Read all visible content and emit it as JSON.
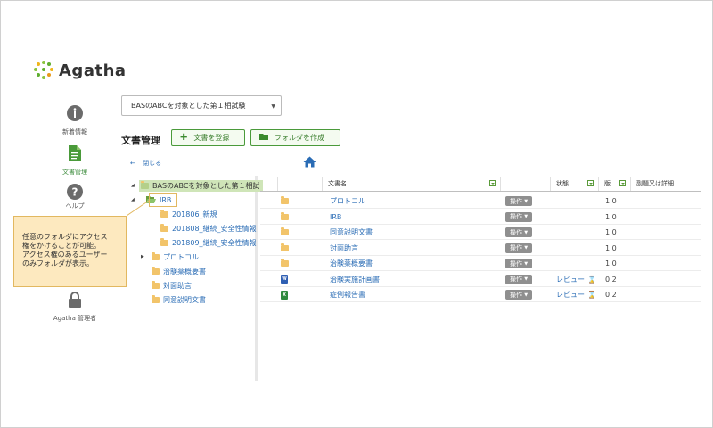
{
  "app": {
    "name": "Agatha"
  },
  "nav": [
    {
      "label": "新着情報",
      "icon": "info-icon"
    },
    {
      "label": "文書管理",
      "icon": "document-icon",
      "active": true
    },
    {
      "label": "ヘルプ",
      "icon": "help-icon"
    },
    {
      "label": "Agatha 管理者",
      "icon": "lock-icon"
    }
  ],
  "study": {
    "selected": "BASのABCを対象とした第１相試験"
  },
  "header": {
    "title": "文書管理",
    "add_doc_label": "文書を登録",
    "create_folder_label": "フォルダを作成"
  },
  "tree": {
    "back_label": "閉じる",
    "root": "BASのABCを対象とした第１相試験",
    "items": [
      {
        "label": "IRB"
      },
      {
        "label": "201806_新規"
      },
      {
        "label": "201808_継続_安全性情報"
      },
      {
        "label": "201809_継続_安全性情報"
      },
      {
        "label": "プロトコル"
      },
      {
        "label": "治験薬概要書"
      },
      {
        "label": "対面助言"
      },
      {
        "label": "同意説明文書"
      }
    ]
  },
  "table": {
    "columns": [
      "文書名",
      "状態",
      "版",
      "副題又は詳細"
    ],
    "op_label": "操作",
    "rows": [
      {
        "name": "プロトコル",
        "type": "folder",
        "status": "",
        "version": "1.0"
      },
      {
        "name": "IRB",
        "type": "folder",
        "status": "",
        "version": "1.0"
      },
      {
        "name": "同意説明文書",
        "type": "folder",
        "status": "",
        "version": "1.0"
      },
      {
        "name": "対面助言",
        "type": "folder",
        "status": "",
        "version": "1.0"
      },
      {
        "name": "治験薬概要書",
        "type": "folder",
        "status": "",
        "version": "1.0"
      },
      {
        "name": "治験実施計画書",
        "type": "word",
        "status": "レビュー",
        "version": "0.2"
      },
      {
        "name": "症例報告書",
        "type": "excel",
        "status": "レビュー",
        "version": "0.2"
      }
    ]
  },
  "callout": {
    "lines": [
      "任意のフォルダにアクセス",
      "権をかけることが可能。",
      "アクセス権のあるユーザー",
      "のみフォルダが表示。"
    ]
  },
  "colors": {
    "accent": "#4a9a3a",
    "link": "#2a6cb5",
    "callout_bg": "#fde9bf"
  }
}
